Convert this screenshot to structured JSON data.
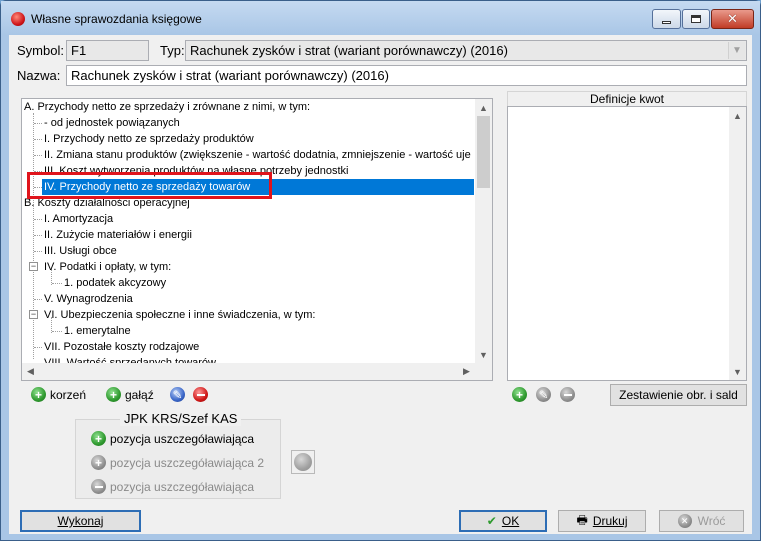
{
  "window": {
    "title": "Własne sprawozdania księgowe"
  },
  "form": {
    "symbol_label": "Symbol:",
    "symbol_value": "F1",
    "typ_label": "Typ:",
    "typ_value": "Rachunek zysków i strat (wariant porównawczy) (2016)",
    "nazwa_label": "Nazwa:",
    "nazwa_value": "Rachunek zysków i strat (wariant porównawczy) (2016)"
  },
  "tree": {
    "items": [
      {
        "label": "A. Przychody netto ze sprzedaży i zrównane z nimi, w tym:"
      },
      {
        "label": "- od jednostek powiązanych"
      },
      {
        "label": "I. Przychody netto ze sprzedaży produktów"
      },
      {
        "label": "II. Zmiana stanu produktów (zwiększenie - wartość dodatnia, zmniejszenie - wartość uje"
      },
      {
        "label": "III. Koszt wytworzenia produktów na własne potrzeby jednostki"
      },
      {
        "label": "IV. Przychody netto ze sprzedaży towarów"
      },
      {
        "label": "B. Koszty działalności operacyjnej"
      },
      {
        "label": "I. Amortyzacja"
      },
      {
        "label": "II. Zużycie materiałów i energii"
      },
      {
        "label": "III. Usługi obce"
      },
      {
        "label": "IV. Podatki i opłaty, w tym:"
      },
      {
        "label": "1. podatek akcyzowy"
      },
      {
        "label": "V. Wynagrodzenia"
      },
      {
        "label": "VI. Ubezpieczenia społeczne i inne świadczenia, w tym:"
      },
      {
        "label": "1. emerytalne"
      },
      {
        "label": "VII. Pozostałe koszty rodzajowe"
      },
      {
        "label": "VIII. Wartość sprzedanych towarów"
      }
    ]
  },
  "definitions": {
    "header": "Definicje kwot"
  },
  "toolbar": {
    "root_label": "korzeń",
    "branch_label": "gałąź",
    "summary_label": "Zestawienie obr. i sald"
  },
  "jpk": {
    "title": "JPK KRS/Szef KAS",
    "add_label": "pozycja uszczegóławiająca",
    "add2_label": "pozycja uszczegóławiająca 2",
    "remove_label": "pozycja uszczegóławiająca"
  },
  "buttons": {
    "execute": "Wykonaj",
    "ok": "OK",
    "print": "Drukuj",
    "back": "Wróć"
  }
}
